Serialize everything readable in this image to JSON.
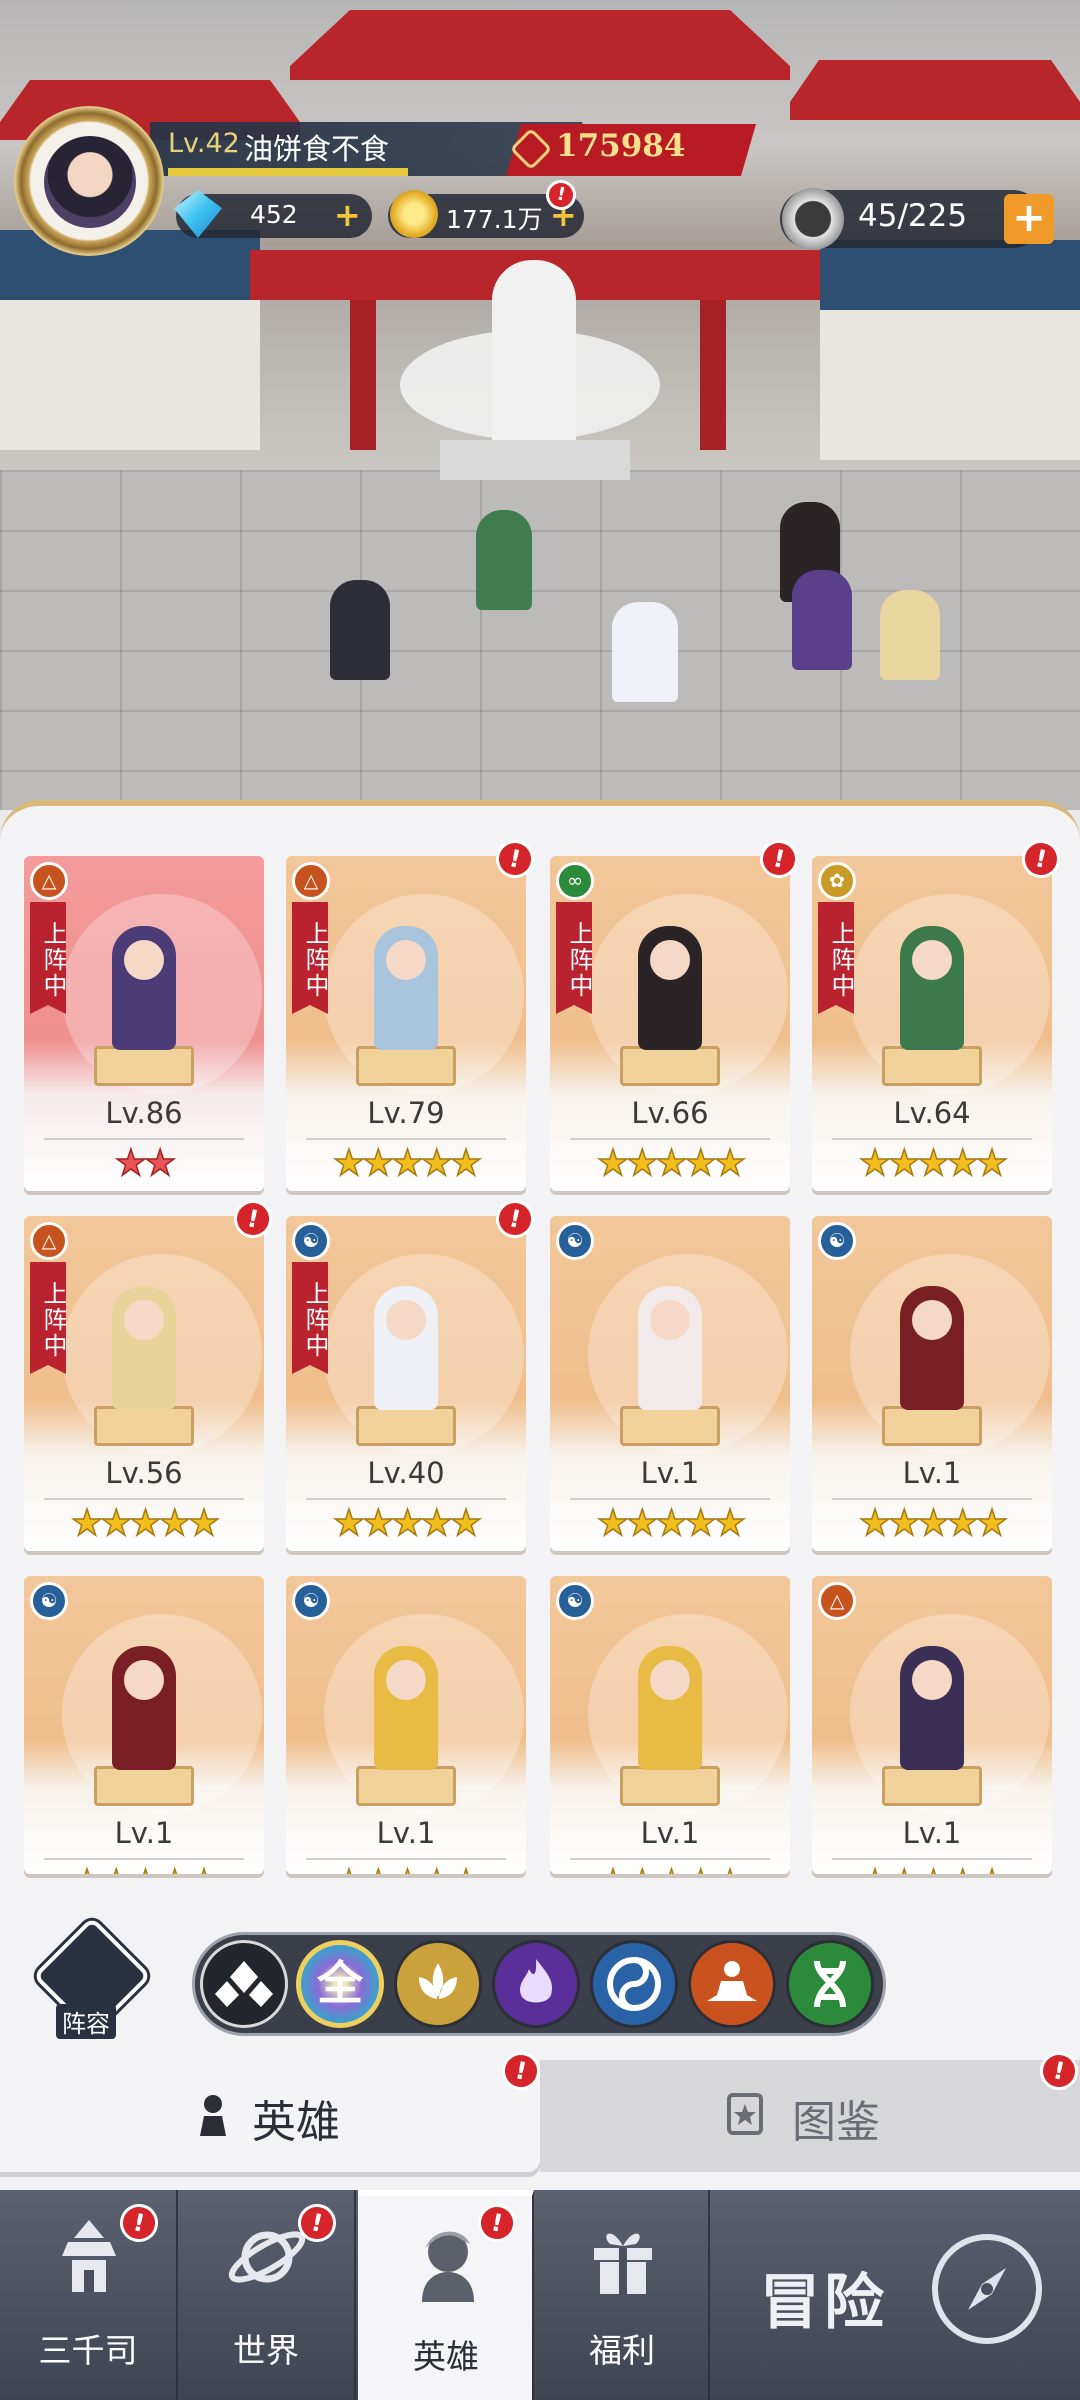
{
  "player": {
    "level_text": "Lv.42",
    "name": "油饼食不食",
    "power": "175984",
    "gems": "452",
    "gold": "177.1万",
    "stamina": "45/225"
  },
  "heroes": [
    {
      "level": "Lv.86",
      "stars": 2,
      "deployed": true,
      "faction": "monk",
      "alert": false,
      "highlight": true,
      "color": "#4b3c78"
    },
    {
      "level": "Lv.79",
      "stars": 5,
      "deployed": true,
      "faction": "monk",
      "alert": true,
      "highlight": false,
      "color": "#a9c4dd"
    },
    {
      "level": "Lv.66",
      "stars": 5,
      "deployed": true,
      "faction": "dna",
      "alert": true,
      "highlight": false,
      "color": "#2a2426"
    },
    {
      "level": "Lv.64",
      "stars": 5,
      "deployed": true,
      "faction": "lotus",
      "alert": true,
      "highlight": false,
      "color": "#3c7a4c"
    },
    {
      "level": "Lv.56",
      "stars": 5,
      "deployed": true,
      "faction": "monk",
      "alert": true,
      "highlight": false,
      "color": "#e8d49a"
    },
    {
      "level": "Lv.40",
      "stars": 5,
      "deployed": true,
      "faction": "yin",
      "alert": true,
      "highlight": false,
      "color": "#eef0f6"
    },
    {
      "level": "Lv.1",
      "stars": 5,
      "deployed": false,
      "faction": "yin",
      "alert": false,
      "highlight": false,
      "color": "#f1e9ea"
    },
    {
      "level": "Lv.1",
      "stars": 5,
      "deployed": false,
      "faction": "yin",
      "alert": false,
      "highlight": false,
      "color": "#7a1f24"
    },
    {
      "level": "Lv.1",
      "stars": 5,
      "deployed": false,
      "faction": "yin",
      "alert": false,
      "highlight": false,
      "color": "#7a1f24"
    },
    {
      "level": "Lv.1",
      "stars": 5,
      "deployed": false,
      "faction": "yin",
      "alert": false,
      "highlight": false,
      "color": "#e8bb44"
    },
    {
      "level": "Lv.1",
      "stars": 5,
      "deployed": false,
      "faction": "yin",
      "alert": false,
      "highlight": false,
      "color": "#e8bb44"
    },
    {
      "level": "Lv.1",
      "stars": 5,
      "deployed": false,
      "faction": "monk",
      "alert": false,
      "highlight": false,
      "color": "#3b2f55"
    }
  ],
  "deployed_label": "上阵中",
  "lineup_label": "阵容",
  "filters": {
    "all_label": "全"
  },
  "tabs": {
    "hero": "英雄",
    "codex": "图鉴"
  },
  "nav": {
    "sanqiansi": "三千司",
    "world": "世界",
    "hero": "英雄",
    "welfare": "福利",
    "adventure": "冒险"
  },
  "colors": {
    "accent_gold": "#f1be1d",
    "alert_red": "#d6242b",
    "banner_red": "#b9222e"
  }
}
